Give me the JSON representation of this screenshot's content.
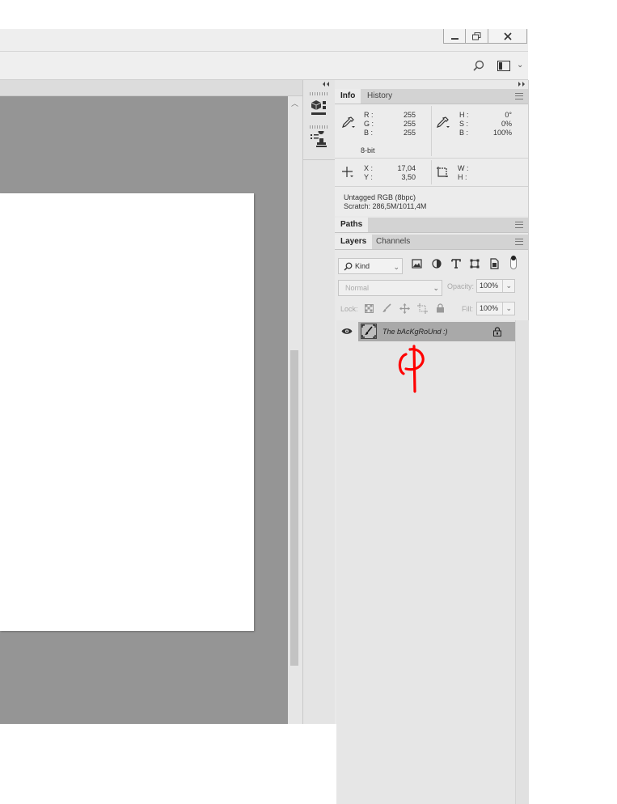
{
  "window": {
    "controls": {
      "minimize": "minimize-icon",
      "restore": "restore-icon",
      "close": "close-icon"
    }
  },
  "options_bar": {
    "search_icon": "search-icon",
    "workspace_icon": "workspace-icon"
  },
  "dock": {
    "collapse_left_icon": "double-chevron-left-icon",
    "collapse_right_icon": "double-chevron-right-icon",
    "items": [
      {
        "icon": "3d-properties-icon"
      },
      {
        "icon": "clone-source-icon"
      }
    ]
  },
  "info_panel": {
    "tabs": [
      "Info",
      "History"
    ],
    "active_tab": "Info",
    "rgb": {
      "r_label": "R :",
      "g_label": "G :",
      "b_label": "B :",
      "r": "255",
      "g": "255",
      "b": "255"
    },
    "hsb": {
      "h_label": "H :",
      "s_label": "S :",
      "b_label": "B :",
      "h": "0°",
      "s": "0%",
      "b": "100%"
    },
    "bit_depth": "8-bit",
    "xy": {
      "x_label": "X :",
      "y_label": "Y :",
      "x": "17,04",
      "y": "3,50"
    },
    "wh": {
      "w_label": "W :",
      "h_label": "H :"
    },
    "doc_profile": "Untagged RGB (8bpc)",
    "scratch": "Scratch: 286,5M/1011,4M"
  },
  "paths_panel": {
    "tab": "Paths"
  },
  "layers_panel": {
    "tabs": [
      "Layers",
      "Channels"
    ],
    "active_tab": "Layers",
    "filter_kind": "Kind",
    "blend_mode": "Normal",
    "opacity_label": "Opacity:",
    "opacity": "100%",
    "lock_label": "Lock:",
    "fill_label": "Fill:",
    "fill": "100%",
    "layers": [
      {
        "name": "The bAcKgRoUnd :)",
        "visible": true,
        "locked": true
      }
    ]
  },
  "annotation": {
    "color": "#ff0000"
  }
}
